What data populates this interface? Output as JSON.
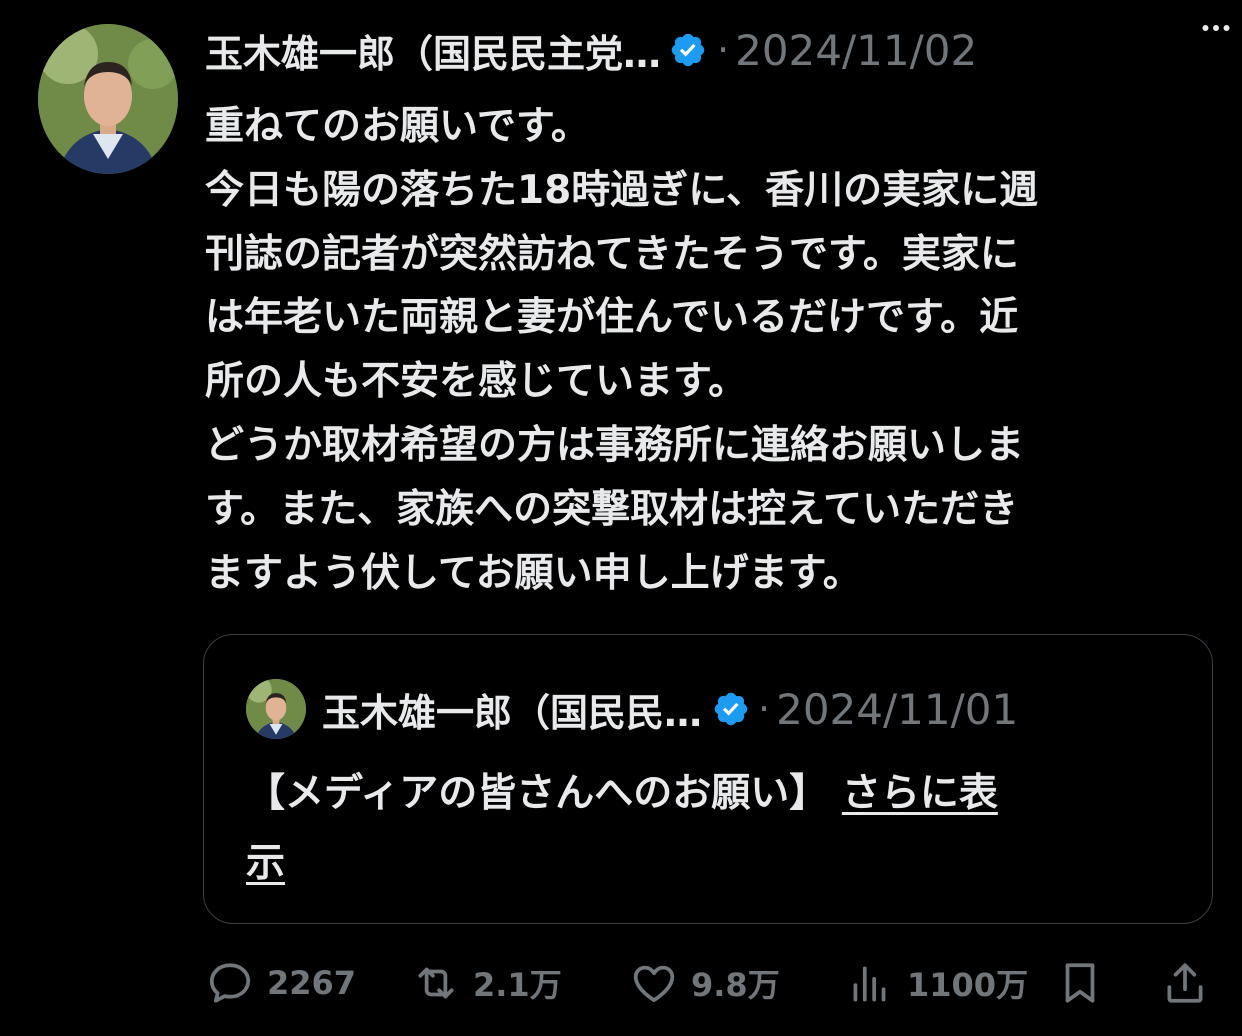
{
  "tweet": {
    "author_name": "玉木雄一郎（国民民主党…",
    "date": "2024/11/02",
    "separator": "·",
    "body_lines": [
      "重ねてのお願いです。",
      "今日も陽の落ちた18時過ぎに、香川の実家に週",
      "刊誌の記者が突然訪ねてきたそうです。実家に",
      "は年老いた両親と妻が住んでいるだけです。近",
      "所の人も不安を感じています。",
      "どうか取材希望の方は事務所に連絡お願いしま",
      "す。また、家族への突撃取材は控えていただき",
      "ますよう伏してお願い申し上げます。"
    ]
  },
  "quoted_tweet": {
    "author_name": "玉木雄一郎（国民民…",
    "date": "2024/11/01",
    "separator": "·",
    "text": "【メディアの皆さんへのお願い】",
    "show_more_line1": "さらに表",
    "show_more_line2": "示"
  },
  "actions": {
    "replies": "2267",
    "retweets": "2.1万",
    "likes": "9.8万",
    "views": "1100万"
  },
  "icons": {
    "verified": "verified-badge-icon",
    "more": "more-options-icon",
    "reply": "reply-icon",
    "retweet": "retweet-icon",
    "like": "heart-icon",
    "views": "views-chart-icon",
    "bookmark": "bookmark-icon",
    "share": "share-icon"
  },
  "colors": {
    "background": "#000000",
    "text": "#e7e9ea",
    "muted": "#71767b",
    "verified": "#1d9bf0",
    "quote_border": "#3b3f44"
  }
}
